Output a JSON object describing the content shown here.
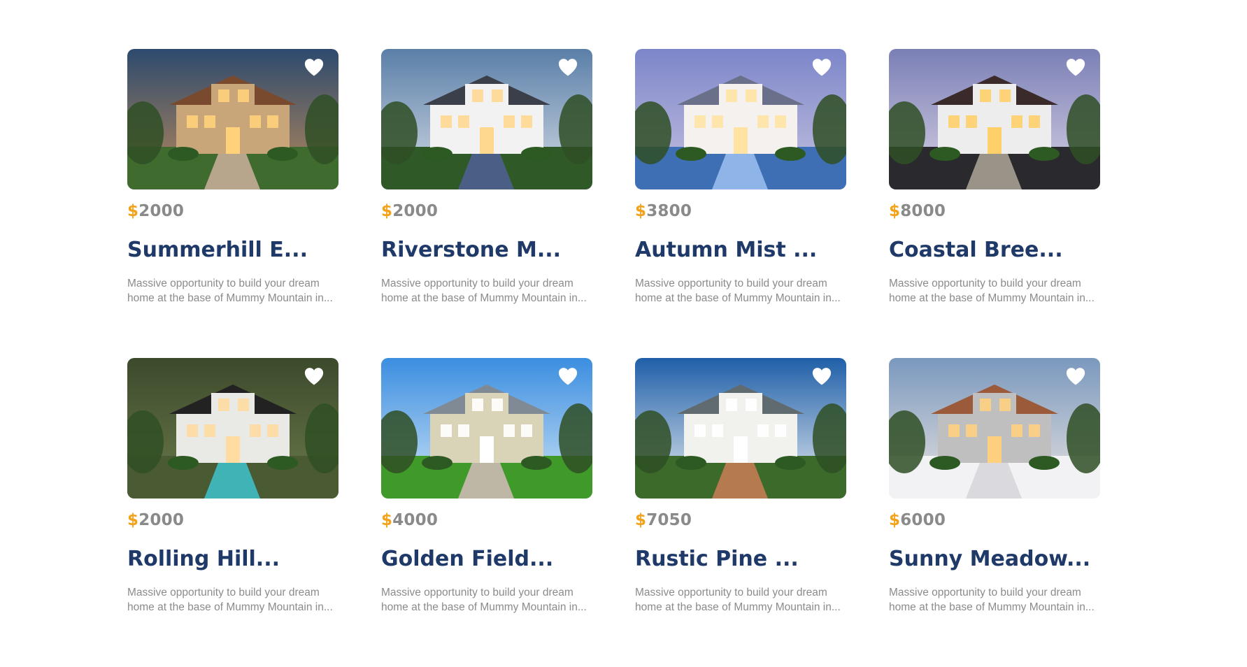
{
  "listings": [
    {
      "image_alt": "Mediterranean villa at dusk",
      "currency": "$",
      "price": "2000",
      "title": "Summerhill E...",
      "desc_line1": "Massive opportunity to build your dream",
      "desc_line2": "home at the base of Mummy Mountain in...",
      "palette": {
        "sky": "#2d4a6e",
        "sky2": "#b98a5a",
        "house": "#c9a679",
        "roof": "#7a4a2e",
        "ground": "#3f6b2f",
        "path": "#b7a58c",
        "glow": "#ffd27a"
      },
      "icon": "heart-icon"
    },
    {
      "image_alt": "Modern white villa with palm trees",
      "currency": "$",
      "price": "2000",
      "title": "Riverstone M...",
      "desc_line1": "Massive opportunity to build your dream",
      "desc_line2": "home at the base of Mummy Mountain in...",
      "palette": {
        "sky": "#5a7fa8",
        "sky2": "#d6dde6",
        "house": "#f2f2f2",
        "roof": "#3a3f4a",
        "ground": "#2f5a28",
        "path": "#4b5f86",
        "glow": "#ffd890"
      },
      "icon": "heart-icon"
    },
    {
      "image_alt": "Colonial mansion with pool at dusk",
      "currency": "$",
      "price": "3800",
      "title": "Autumn Mist ...",
      "desc_line1": "Massive opportunity to build your dream",
      "desc_line2": "home at the base of Mummy Mountain in...",
      "palette": {
        "sky": "#7c86c9",
        "sky2": "#c7c3e0",
        "house": "#f4f1ee",
        "roof": "#6a6f8a",
        "ground": "#3e6fb5",
        "path": "#8fb5e8",
        "glow": "#ffe3a3"
      },
      "icon": "heart-icon"
    },
    {
      "image_alt": "Two-storey house rendering at dusk",
      "currency": "$",
      "price": "8000",
      "title": "Coastal Bree...",
      "desc_line1": "Massive opportunity to build your dream",
      "desc_line2": "home at the base of Mummy Mountain in...",
      "palette": {
        "sky": "#7a7fb5",
        "sky2": "#d9d3e6",
        "house": "#ededed",
        "roof": "#3b2a2a",
        "ground": "#2a2a2e",
        "path": "#9a9388",
        "glow": "#ffcf6a"
      },
      "icon": "heart-icon"
    },
    {
      "image_alt": "Aerial view of modern house with pool",
      "currency": "$",
      "price": "2000",
      "title": "Rolling Hill...",
      "desc_line1": "Massive opportunity to build your dream",
      "desc_line2": "home at the base of Mummy Mountain in...",
      "palette": {
        "sky": "#3c4a2c",
        "sky2": "#6b7a4a",
        "house": "#e9e9e6",
        "roof": "#222222",
        "ground": "#4a5a32",
        "path": "#3fb3b6",
        "glow": "#ffdca0"
      },
      "icon": "heart-icon"
    },
    {
      "image_alt": "Craftsman house with lawn",
      "currency": "$",
      "price": "4000",
      "title": "Golden Field...",
      "desc_line1": "Massive opportunity to build your dream",
      "desc_line2": "home at the base of Mummy Mountain in...",
      "palette": {
        "sky": "#3b8ee0",
        "sky2": "#cfe4f7",
        "house": "#d9d3b8",
        "roof": "#7f8a95",
        "ground": "#3f9a2a",
        "path": "#bfb7a6",
        "glow": "#ffffff"
      },
      "icon": "heart-icon"
    },
    {
      "image_alt": "Victorian mansion with palm trees",
      "currency": "$",
      "price": "7050",
      "title": "Rustic Pine ...",
      "desc_line1": "Massive opportunity to build your dream",
      "desc_line2": "home at the base of Mummy Mountain in...",
      "palette": {
        "sky": "#1f5fa8",
        "sky2": "#eaeef2",
        "house": "#f1f1ee",
        "roof": "#5f6b6f",
        "ground": "#3b6a2a",
        "path": "#b57a4e",
        "glow": "#ffffff"
      },
      "icon": "heart-icon"
    },
    {
      "image_alt": "Modern house in snow",
      "currency": "$",
      "price": "6000",
      "title": "Sunny Meadow...",
      "desc_line1": "Massive opportunity to build your dream",
      "desc_line2": "home at the base of Mummy Mountain in...",
      "palette": {
        "sky": "#7a98bd",
        "sky2": "#eae4e2",
        "house": "#bfbfc0",
        "roof": "#9b5a3a",
        "ground": "#f2f2f4",
        "path": "#d9d9de",
        "glow": "#ffcf80"
      },
      "icon": "heart-icon"
    }
  ],
  "colors": {
    "accent": "#f3a21b",
    "title": "#1f3a68",
    "price": "#8a8a8a",
    "muted": "#8b8b8b"
  }
}
